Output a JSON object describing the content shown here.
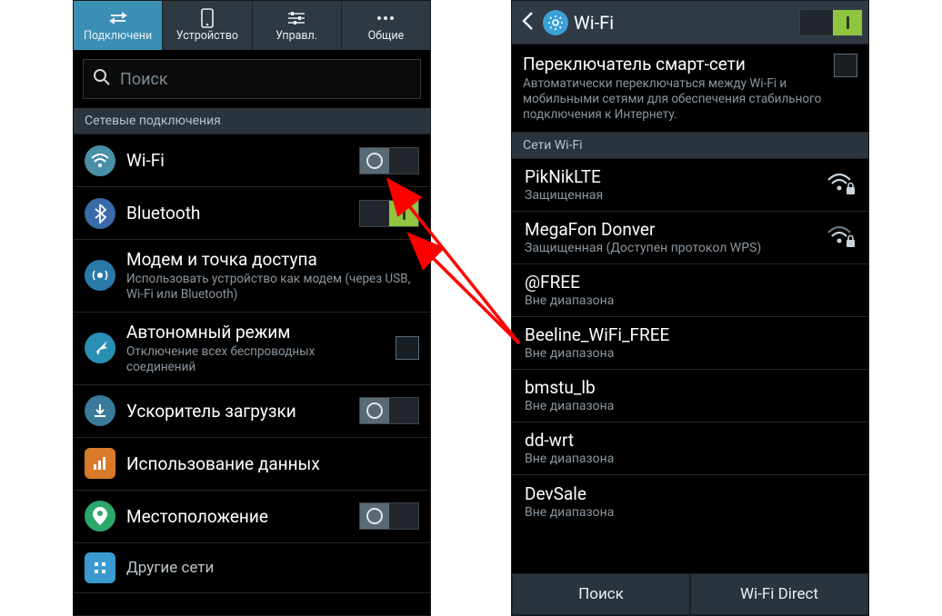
{
  "colors": {
    "accent_blue": "#3b8fb5",
    "toggle_on": "#8fc53f",
    "toggle_off": "#5a6a75",
    "arrow": "#ff0000"
  },
  "left": {
    "tabs": [
      {
        "icon": "swap-icon",
        "label": "Подключени"
      },
      {
        "icon": "device-icon",
        "label": "Устройство"
      },
      {
        "icon": "sliders-icon",
        "label": "Управл."
      },
      {
        "icon": "more-icon",
        "label": "Общие"
      }
    ],
    "search_placeholder": "Поиск",
    "section": "Сетевые подключения",
    "items": [
      {
        "icon": "wifi-circle",
        "title": "Wi-Fi",
        "sub": "",
        "control": "toggle-off"
      },
      {
        "icon": "bluetooth-circle",
        "title": "Bluetooth",
        "sub": "",
        "control": "toggle-on"
      },
      {
        "icon": "hotspot-circle",
        "title": "Модем и точка доступа",
        "sub": "Использовать устройство как модем (через USB, Wi-Fi или Bluetooth)",
        "control": "none"
      },
      {
        "icon": "airplane-circle",
        "title": "Автономный режим",
        "sub": "Отключение всех беспроводных соединений",
        "control": "checkbox"
      },
      {
        "icon": "boost-circle",
        "title": "Ускоритель загрузки",
        "sub": "",
        "control": "toggle-off"
      },
      {
        "icon": "data-circle",
        "title": "Использование данных",
        "sub": "",
        "control": "none"
      },
      {
        "icon": "location-circle",
        "title": "Местоположение",
        "sub": "",
        "control": "toggle-off"
      },
      {
        "icon": "other-circle",
        "title": "Другие сети",
        "sub": "",
        "control": "none"
      }
    ]
  },
  "right": {
    "title": "Wi-Fi",
    "master_toggle": "on",
    "smart": {
      "title": "Переключатель смарт-сети",
      "sub": "Автоматически переключаться между Wi-Fi и мобильными сетями для обеспечения стабильного подключения к Интернету."
    },
    "section": "Сети Wi-Fi",
    "networks": [
      {
        "name": "PikNikLTE",
        "sub": "Защищенная",
        "signal": true,
        "locked": true
      },
      {
        "name": "MegaFon Donver",
        "sub": "Защищенная (Доступен протокол WPS)",
        "signal": true,
        "locked": true
      },
      {
        "name": "@FREE",
        "sub": "Вне диапазона",
        "signal": false,
        "locked": false
      },
      {
        "name": "Beeline_WiFi_FREE",
        "sub": "Вне диапазона",
        "signal": false,
        "locked": false
      },
      {
        "name": "bmstu_lb",
        "sub": "Вне диапазона",
        "signal": false,
        "locked": false
      },
      {
        "name": "dd-wrt",
        "sub": "Вне диапазона",
        "signal": false,
        "locked": false
      },
      {
        "name": "DevSale",
        "sub": "Вне диапазона",
        "signal": false,
        "locked": false
      }
    ],
    "buttons": {
      "search": "Поиск",
      "direct": "Wi-Fi Direct"
    }
  }
}
